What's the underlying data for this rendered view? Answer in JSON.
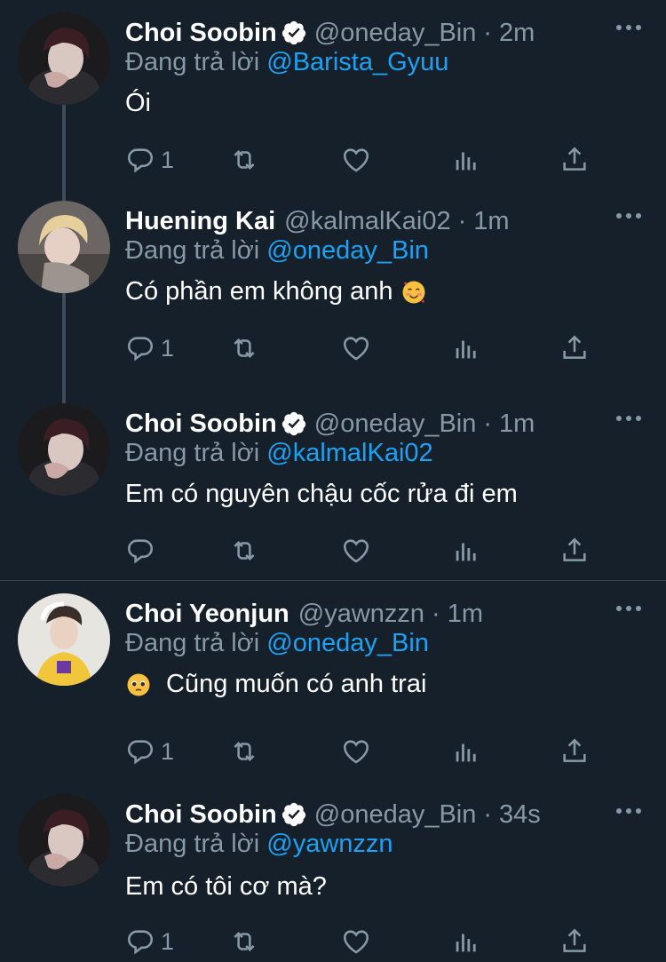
{
  "colors": {
    "background": "#15202b",
    "secondary_text": "#8899a6",
    "link": "#1da1f2",
    "verified": "#ffffff",
    "thread_line": "#3d4c5a"
  },
  "tweets": [
    {
      "name": "Choi Soobin",
      "verified": true,
      "handle": "@oneday_Bin",
      "dot": "·",
      "time": "2m",
      "reply_prefix": "Đang trả lời",
      "reply_to": "@Barista_Gyuu",
      "text": "Ói",
      "emoji_before": "",
      "emoji_after": "",
      "reply_count": "1",
      "avatar": "dark-hair-avatar"
    },
    {
      "name": "Huening Kai",
      "verified": false,
      "handle": "@kalmalKai02",
      "dot": "·",
      "time": "1m",
      "reply_prefix": "Đang trả lời",
      "reply_to": "@oneday_Bin",
      "text": "Có phần em không anh",
      "emoji_after": "smiling-face-with-hearts",
      "reply_count": "1",
      "avatar": "blonde-hair-avatar"
    },
    {
      "name": "Choi Soobin",
      "verified": true,
      "handle": "@oneday_Bin",
      "dot": "·",
      "time": "1m",
      "reply_prefix": "Đang trả lời",
      "reply_to": "@kalmalKai02",
      "text": "Em có nguyên chậu cốc rửa đi em",
      "reply_count": "",
      "avatar": "dark-hair-avatar"
    },
    {
      "name": "Choi Yeonjun",
      "verified": false,
      "handle": "@yawnzzn",
      "dot": "·",
      "time": "1m",
      "reply_prefix": "Đang trả lời",
      "reply_to": "@oneday_Bin",
      "text": "Cũng muốn có anh trai",
      "emoji_before": "pleading-face",
      "reply_count": "1",
      "avatar": "jersey-avatar"
    },
    {
      "name": "Choi Soobin",
      "verified": true,
      "handle": "@oneday_Bin",
      "dot": "·",
      "time": "34s",
      "reply_prefix": "Đang trả lời",
      "reply_to": "@yawnzzn",
      "text": "Em có tôi cơ mà?",
      "reply_count": "1",
      "avatar": "dark-hair-avatar"
    }
  ],
  "icons": {
    "reply": "reply-icon",
    "retweet": "retweet-icon",
    "like": "heart-icon",
    "stats": "analytics-icon",
    "share": "share-icon",
    "more": "more-icon",
    "verified": "verified-badge-icon"
  }
}
